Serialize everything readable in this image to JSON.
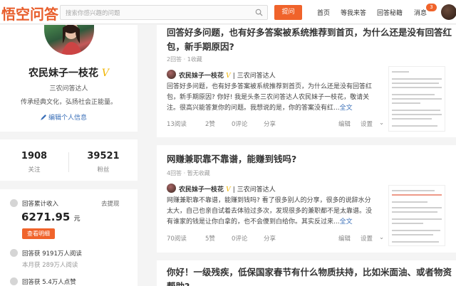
{
  "header": {
    "logo": "悟空问答",
    "search_placeholder": "搜索你感兴趣的问题",
    "ask_label": "提问",
    "nav": [
      "首页",
      "等我来答",
      "回答秘籍",
      "消息"
    ],
    "message_count": "3"
  },
  "profile": {
    "name": "农民妹子一枝花",
    "verified_mark": "V",
    "title": "三农问答达人",
    "slogan": "传承经典文化，弘扬社会正能量。",
    "edit_label": "编辑个人信息"
  },
  "stats": {
    "following": "1908",
    "following_label": "关注",
    "fans": "39521",
    "fans_label": "粉丝"
  },
  "income": {
    "label": "回答累计收入",
    "withdraw": "去提现",
    "amount": "6271.95",
    "unit": "元",
    "detail_label": "查看明细",
    "reads_label_pre": "回答获",
    "reads_value": "9191万人阅读",
    "month_reads": "本月获 289万人阅读",
    "likes_pre": "回答获",
    "likes_value": "5.4万人点赞"
  },
  "questions": [
    {
      "title": "回答好多问题，也有好多答案被系统推荐到首页，为什么还是没有回答红包，新手期原因?",
      "meta": "2回答 · 1收藏",
      "author": "农民妹子一枝花",
      "author_title": "三农问答达人",
      "excerpt": "回答好多问题，也有好多答案被系统推荐到首页，为什么还是没有回答红包，新手期原因? 你好! 我是头条三农问答达人农民妹子一枝花，敬请关注。很高兴能答复你的问题。我想说的是，你的答案没有红...",
      "more": "全文",
      "reads": "13阅读",
      "likes": "2赞",
      "comments": "0评论",
      "share": "分享",
      "edit": "编辑",
      "settings": "设置"
    },
    {
      "title": "网赚兼职靠不靠谱，能赚到钱吗?",
      "meta": "4回答 · 暂无收藏",
      "author": "农民妹子一枝花",
      "author_title": "三农问答达人",
      "excerpt": "网赚兼职靠不靠谱，能赚到钱吗? 看了很多别人的分享，很多的说辞水分太大，自己也亲自试着去体验过多次，发现很多的兼职都不是太靠谱。没有谁家的钱是让你白拿的，也不会傻到白给你。其实反过来...",
      "more": "全文",
      "reads": "70阅读",
      "likes": "5赞",
      "comments": "0评论",
      "share": "分享",
      "edit": "编辑",
      "settings": "设置"
    },
    {
      "title": "你好！一级残疾，低保国家春节有什么物质扶持，比如米面油、或者物资帮助?"
    }
  ],
  "colors": {
    "accent": "#f0632b",
    "link": "#3a6fb8",
    "verified": "#f0b400"
  }
}
